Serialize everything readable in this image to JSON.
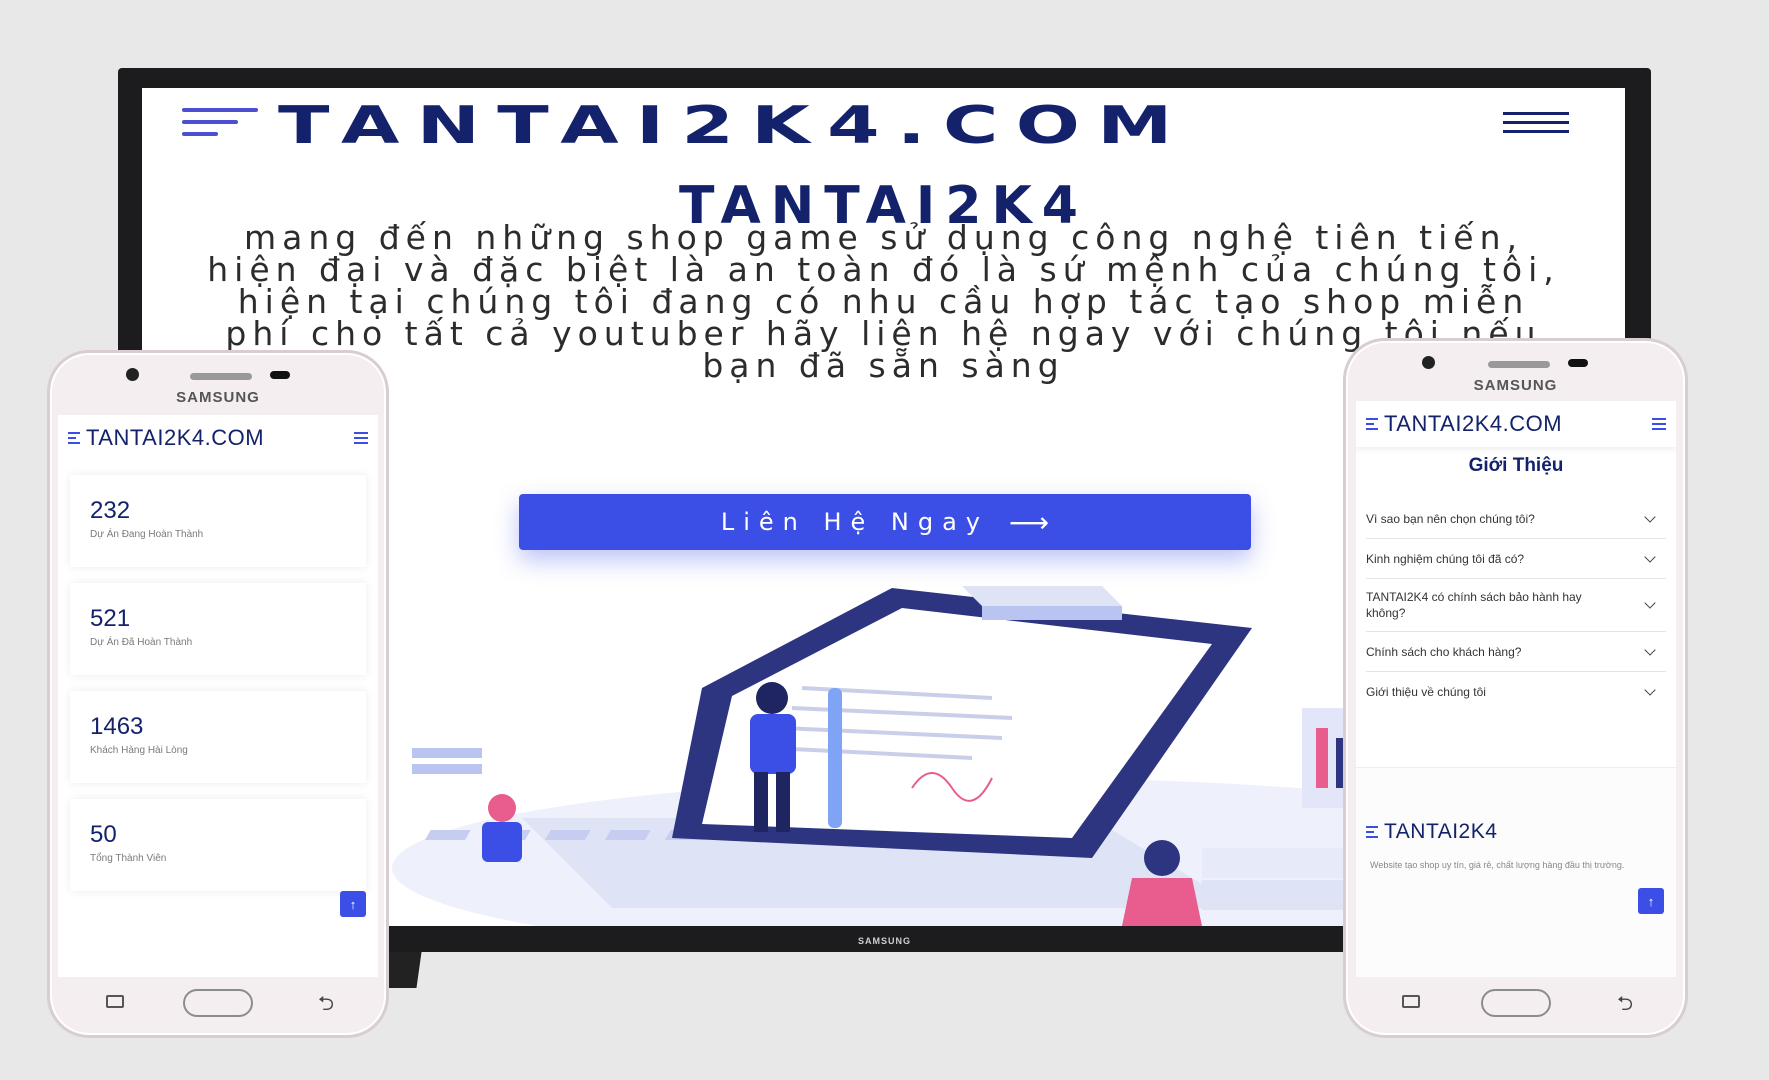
{
  "tv": {
    "logo": "TANTAI2K4.COM",
    "hero_title": "TANTAI2K4",
    "hero_text": "mang đến những shop game sử dụng công nghệ tiên tiến, hiện đại và đặc biệt là an toàn đó là sứ mệnh của chúng tôi, hiện tại chúng tôi đang có nhu cầu hợp tác tạo shop miễn phí cho tất cả youtuber hãy liên hệ ngay với chúng tôi nếu bạn đã sẵn sàng",
    "cta_label": "Liên Hệ Ngay",
    "cta_arrow": "⟶",
    "brand": "SAMSUNG"
  },
  "phone_left": {
    "brand": "SAMSUNG",
    "logo": "TANTAI2K4.COM",
    "stats": [
      {
        "value": "232",
        "label": "Dự Án Đang Hoàn Thành"
      },
      {
        "value": "521",
        "label": "Dự Án Đã Hoàn Thành"
      },
      {
        "value": "1463",
        "label": "Khách Hàng Hài Lòng"
      },
      {
        "value": "50",
        "label": "Tổng Thành Viên"
      }
    ],
    "to_top": "↑"
  },
  "phone_right": {
    "brand": "SAMSUNG",
    "logo": "TANTAI2K4.COM",
    "section_title": "Giới Thiệu",
    "faq": [
      "Vì sao bạn nên chọn chúng tôi?",
      "Kinh nghiệm chúng tôi đã có?",
      "TANTAI2K4 có chính sách bảo hành hay không?",
      "Chính sách cho khách hàng?",
      "Giới thiệu về chúng tôi"
    ],
    "footer_logo": "TANTAI2K4",
    "footer_text": "Website tạo shop uy tín, giá rẻ, chất lượng hàng đầu thị trường.",
    "to_top": "↑"
  },
  "colors": {
    "accent": "#3b4fe6",
    "navy": "#13226b",
    "background": "#e8e8e8"
  }
}
